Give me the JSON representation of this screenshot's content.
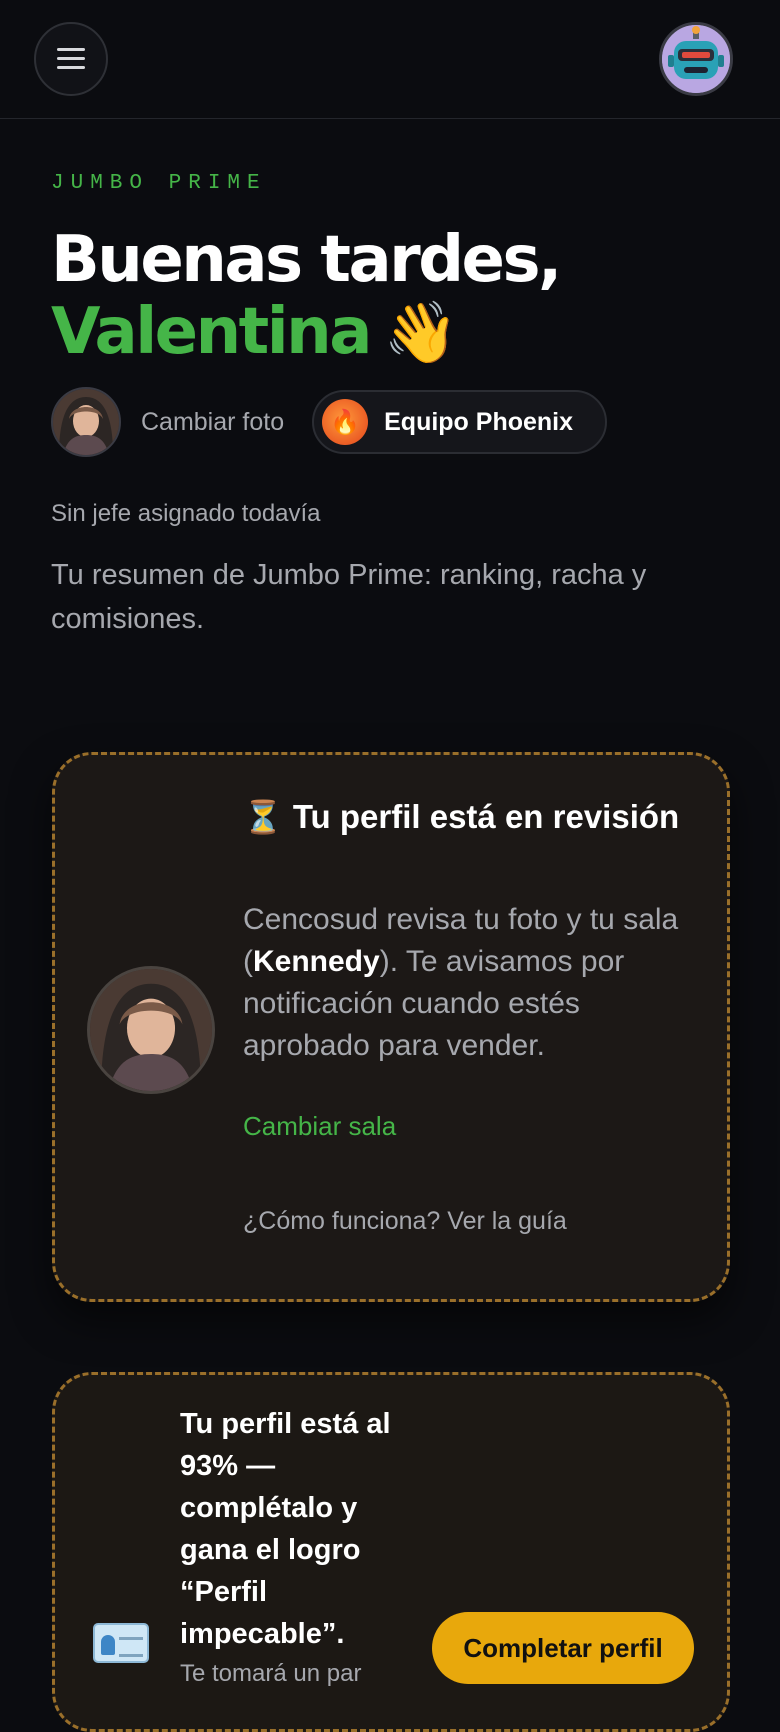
{
  "header": {
    "menu_icon": "hamburger-menu-icon",
    "avatar_icon": "robot-avatar-icon"
  },
  "hero": {
    "eyebrow": "JUMBO PRIME",
    "greeting_line": "Buenas tardes,",
    "name": "Valentina",
    "wave_emoji": "👋",
    "change_photo": "Cambiar foto",
    "team_emoji": "🔥",
    "team_name": "Equipo Phoenix",
    "no_boss": "Sin jefe asignado todavía",
    "summary": "Tu resumen de Jumbo Prime: ranking, racha y comisiones."
  },
  "review_card": {
    "hourglass_emoji": "⏳",
    "title": "Tu perfil está en revisión",
    "body_prefix": "Cencosud revisa tu foto y tu sala (",
    "store": "Kennedy",
    "body_suffix": "). Te avisamos por notificación cuando estés aprobado para vender.",
    "change_room": "Cambiar sala",
    "guide": "¿Cómo funciona? Ver la guía"
  },
  "complete_card": {
    "icon": "id-card-icon",
    "title": "Tu perfil está al 93% — complétalo y gana el logro “Perfil impecable”.",
    "progress_percent": 93,
    "subtitle": "Te tomará un par",
    "button": "Completar perfil"
  },
  "colors": {
    "accent_green": "#45b548",
    "warning_amber": "#e8a80c",
    "background": "#0b0c10"
  }
}
